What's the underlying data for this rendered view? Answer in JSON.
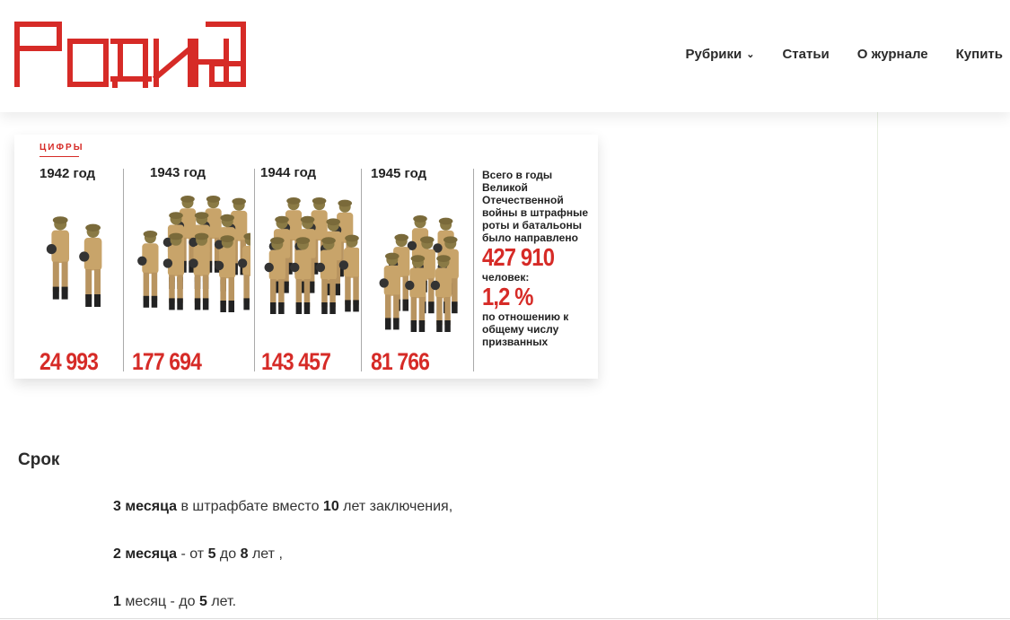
{
  "logo": {
    "text": "Родина",
    "color": "#d62b27"
  },
  "nav": {
    "items": [
      {
        "label": "Рубрики",
        "has_dropdown": true
      },
      {
        "label": "Статьи"
      },
      {
        "label": "О журнале"
      },
      {
        "label": "Купить"
      }
    ]
  },
  "infographic": {
    "tag": "ЦИФРЫ",
    "columns": [
      {
        "year": "1942 год",
        "count": "24 993"
      },
      {
        "year": "1943 год",
        "count": "177 694"
      },
      {
        "year": "1944 год",
        "count": "143 457"
      },
      {
        "year": "1945 год",
        "count": "81 766"
      }
    ],
    "summary": {
      "intro": "Всего в годы Великой Отечественной войны в штрафные роты и батальоны было направлено",
      "total": "427 910",
      "people": "человек:",
      "percent": "1,2 %",
      "outro": "по отношению к общему числу призванных"
    },
    "accent_color": "#d62b27"
  },
  "article": {
    "section_title": "Срок",
    "lines": [
      {
        "a": "3 месяца",
        "b": " в штрафбате вместо ",
        "c": "10",
        "d": " лет заключения,"
      },
      {
        "a": "2 месяца",
        "b": " - от ",
        "c": "5",
        "d": " до ",
        "e": "8",
        "f": " лет ,"
      },
      {
        "a": "1",
        "b": " месяц - до ",
        "c": "5",
        "d": " лет."
      }
    ]
  }
}
